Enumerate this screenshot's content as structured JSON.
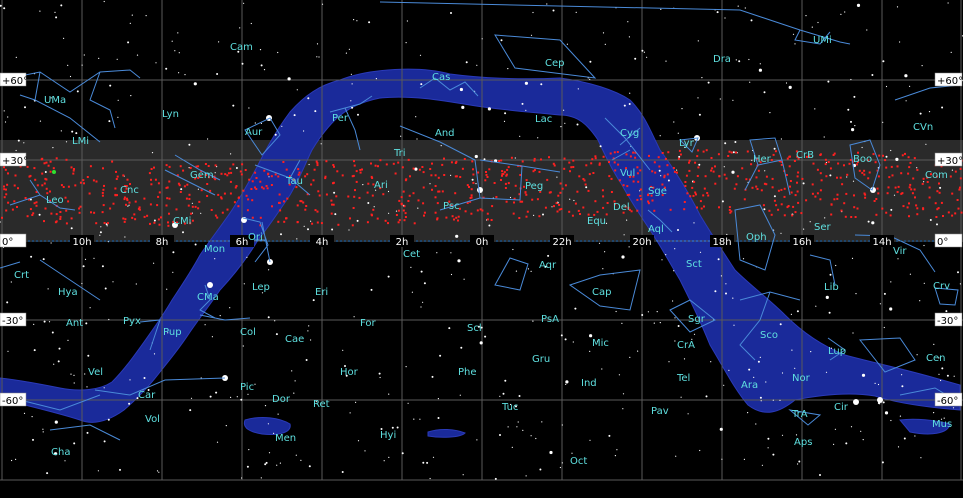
{
  "map": {
    "ra_labels": [
      "10h",
      "8h",
      "6h",
      "4h",
      "2h",
      "0h",
      "22h",
      "20h",
      "18h",
      "16h",
      "14h"
    ],
    "dec_labels_left": [
      "+60°",
      "+30°",
      "0°",
      "-30°",
      "-60°"
    ],
    "dec_labels_right": [
      "+60°",
      "+30°",
      "0°",
      "-30°",
      "-60°"
    ],
    "constellations": [
      {
        "name": "UMi"
      },
      {
        "name": "Cam"
      },
      {
        "name": "Dra"
      },
      {
        "name": "Cep"
      },
      {
        "name": "Cas"
      },
      {
        "name": "UMa"
      },
      {
        "name": "Lyn"
      },
      {
        "name": "LMi"
      },
      {
        "name": "Aur"
      },
      {
        "name": "Per"
      },
      {
        "name": "And"
      },
      {
        "name": "Lac"
      },
      {
        "name": "Cyg"
      },
      {
        "name": "Lyr"
      },
      {
        "name": "Her"
      },
      {
        "name": "CrB"
      },
      {
        "name": "Boo"
      },
      {
        "name": "CVn"
      },
      {
        "name": "Com"
      },
      {
        "name": "Tri"
      },
      {
        "name": "Gem"
      },
      {
        "name": "Tau"
      },
      {
        "name": "Ari"
      },
      {
        "name": "Cnc"
      },
      {
        "name": "Leo"
      },
      {
        "name": "Peg"
      },
      {
        "name": "Vul"
      },
      {
        "name": "Sge"
      },
      {
        "name": "Del"
      },
      {
        "name": "Psc"
      },
      {
        "name": "Equ"
      },
      {
        "name": "CMi"
      },
      {
        "name": "Aql"
      },
      {
        "name": "Ser"
      },
      {
        "name": "Mon"
      },
      {
        "name": "Ori"
      },
      {
        "name": "Oph"
      },
      {
        "name": "Vir"
      },
      {
        "name": "Cet"
      },
      {
        "name": "Aqr"
      },
      {
        "name": "Sct"
      },
      {
        "name": "Crt"
      },
      {
        "name": "Hya"
      },
      {
        "name": "Lep"
      },
      {
        "name": "Eri"
      },
      {
        "name": "Cap"
      },
      {
        "name": "Lib"
      },
      {
        "name": "Crv"
      },
      {
        "name": "CMa"
      },
      {
        "name": "Sgr"
      },
      {
        "name": "Ant"
      },
      {
        "name": "Pyx"
      },
      {
        "name": "For"
      },
      {
        "name": "Scl"
      },
      {
        "name": "PsA"
      },
      {
        "name": "Pup"
      },
      {
        "name": "Col"
      },
      {
        "name": "Mic"
      },
      {
        "name": "Sco"
      },
      {
        "name": "Cae"
      },
      {
        "name": "Lup"
      },
      {
        "name": "CrA"
      },
      {
        "name": "Cen"
      },
      {
        "name": "Vel"
      },
      {
        "name": "Hor"
      },
      {
        "name": "Phe"
      },
      {
        "name": "Gru"
      },
      {
        "name": "Nor"
      },
      {
        "name": "Car"
      },
      {
        "name": "Pic"
      },
      {
        "name": "Ind"
      },
      {
        "name": "Tel"
      },
      {
        "name": "Ara"
      },
      {
        "name": "Dor"
      },
      {
        "name": "Ret"
      },
      {
        "name": "Tuc"
      },
      {
        "name": "Pav"
      },
      {
        "name": "TrA"
      },
      {
        "name": "Cir"
      },
      {
        "name": "Mus"
      },
      {
        "name": "Vol"
      },
      {
        "name": "Men"
      },
      {
        "name": "Hyi"
      },
      {
        "name": "Aps"
      },
      {
        "name": "Cha"
      },
      {
        "name": "Oct"
      }
    ]
  },
  "colors": {
    "background": "#000000",
    "grid": "#5a5a5a",
    "constellation_lines": "#4a8ad8",
    "constellation_labels": "#5fe0e0",
    "milky_way": "#1a2a9a",
    "ecliptic_band": "#2a2a2a",
    "asteroids": "#ff2020",
    "stars": "#ffffff"
  }
}
